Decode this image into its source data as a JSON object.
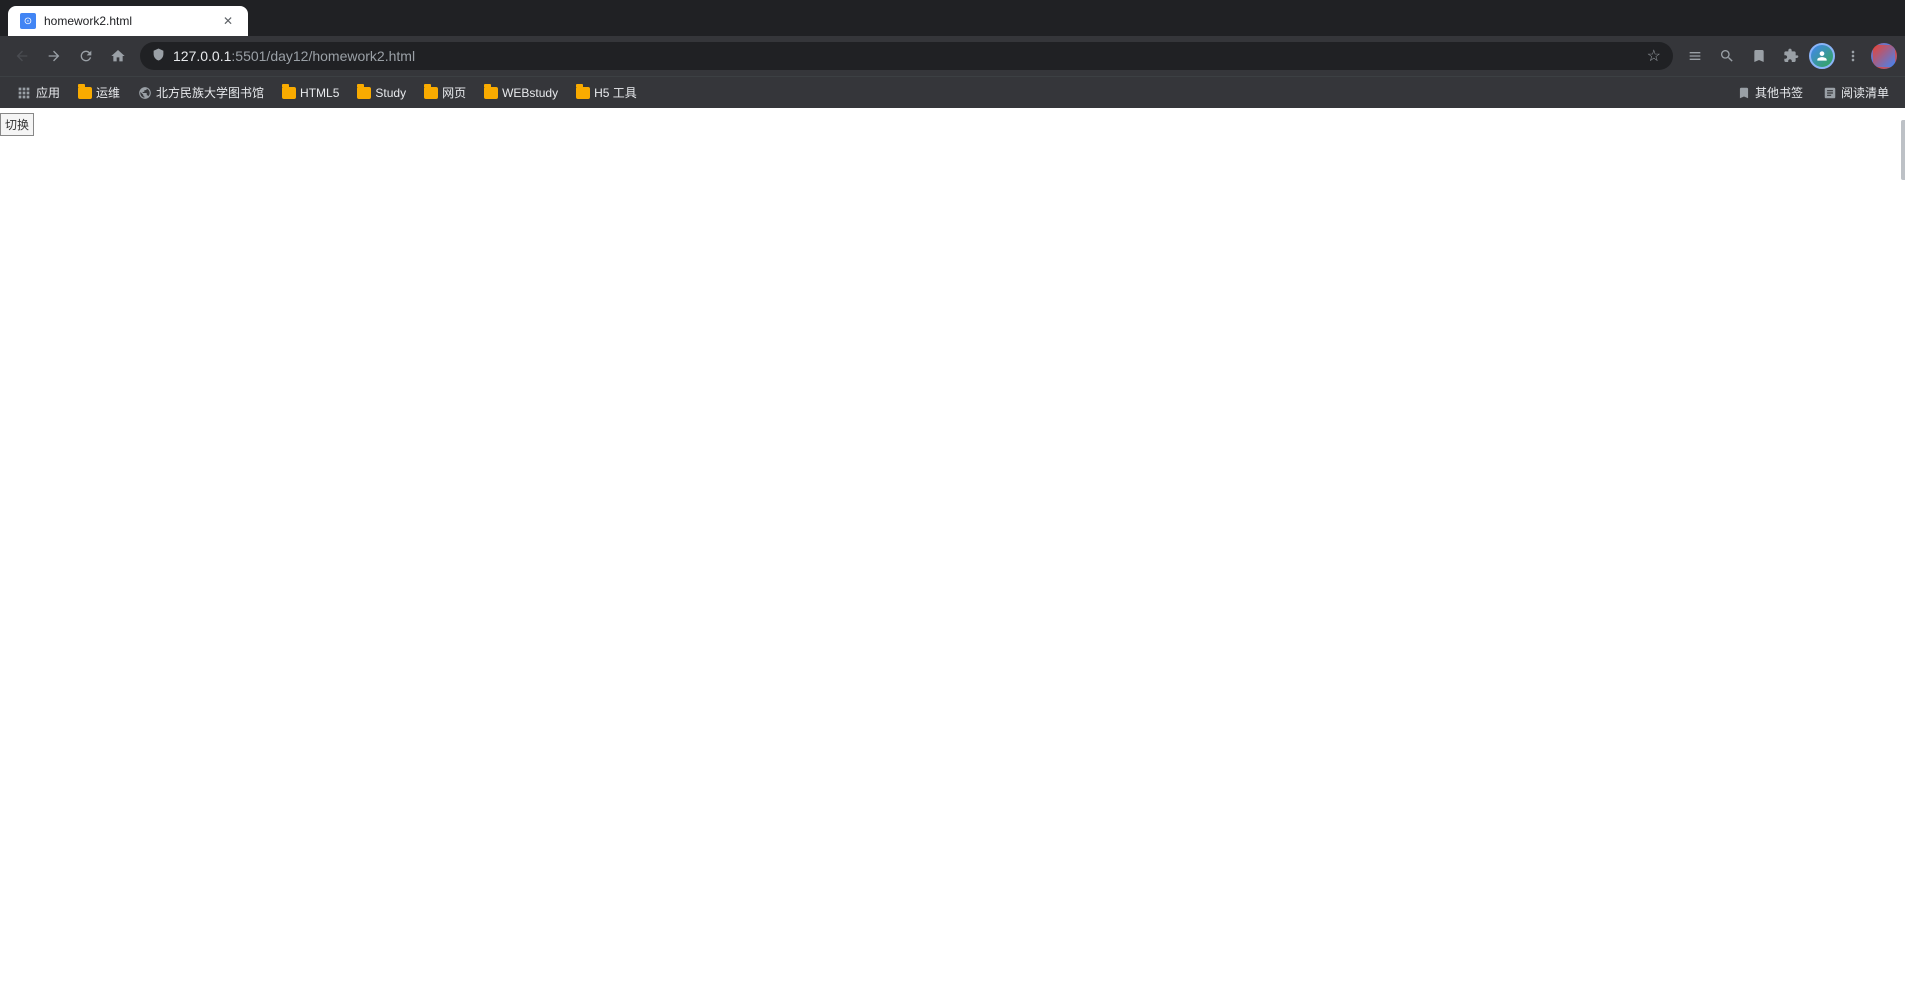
{
  "browser": {
    "tab": {
      "title": "homework2.html",
      "favicon": "H"
    },
    "nav": {
      "back_tooltip": "Back",
      "forward_tooltip": "Forward",
      "reload_tooltip": "Reload",
      "home_tooltip": "Home",
      "address": {
        "full": "127.0.0.1:5501/day12/homework2.html",
        "host": "127.0.0.1",
        "port_path": ":5501/day12/homework2.html"
      },
      "search_tooltip": "Search",
      "bookmark_tooltip": "Bookmark",
      "extensions_tooltip": "Extensions",
      "settings_tooltip": "Settings",
      "profile_tooltip": "Profile"
    },
    "bookmarks": [
      {
        "id": "apps",
        "label": "应用",
        "type": "apps"
      },
      {
        "id": "yunwei",
        "label": "运维",
        "type": "folder"
      },
      {
        "id": "library",
        "label": "北方民族大学图书馆",
        "type": "globe"
      },
      {
        "id": "html5",
        "label": "HTML5",
        "type": "folder"
      },
      {
        "id": "study",
        "label": "Study",
        "type": "folder"
      },
      {
        "id": "webpage",
        "label": "网页",
        "type": "folder"
      },
      {
        "id": "webstudy",
        "label": "WEBstudy",
        "type": "folder"
      },
      {
        "id": "h5tools",
        "label": "H5 工具",
        "type": "folder"
      }
    ],
    "bookmarks_right": [
      {
        "id": "other-bookmarks",
        "label": "其他书签",
        "type": "bookmark-list"
      },
      {
        "id": "reading-list",
        "label": "阅读清单",
        "type": "reading-list"
      }
    ]
  },
  "page": {
    "button_label": "切换"
  }
}
